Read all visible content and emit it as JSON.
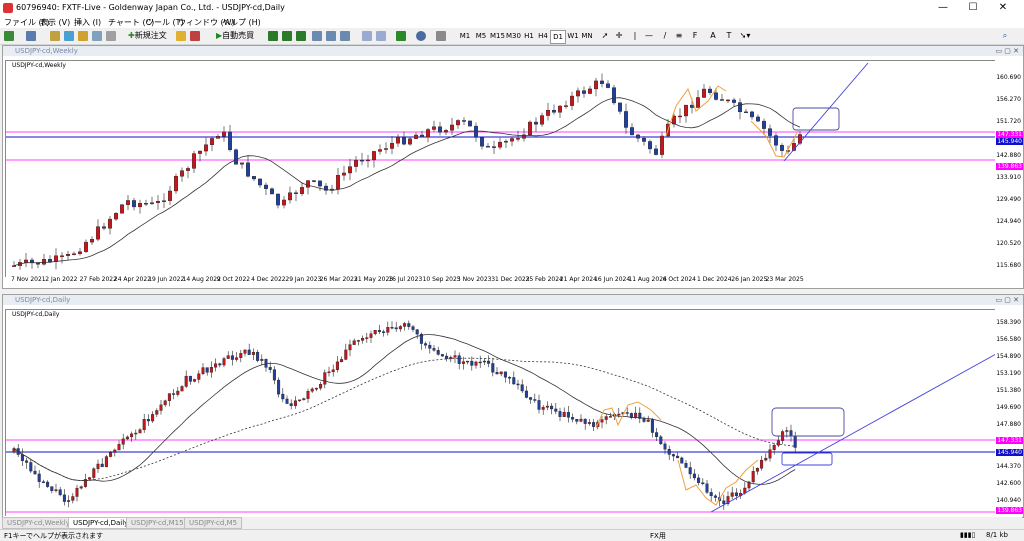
{
  "window": {
    "title": "60796940: FXTF-Live - Goldenway Japan Co., Ltd. - USDJPY-cd,Daily",
    "minimize": "—",
    "maximize": "☐",
    "close": "✕"
  },
  "menu": [
    "ファイル (F)",
    "表示 (V)",
    "挿入 (I)",
    "チャート (C)",
    "ツール (T)",
    "ウィンドウ (W)",
    "ヘルプ (H)"
  ],
  "toolbar": {
    "new_order": "新規注文",
    "auto_trade": "自動売買",
    "timeframes": [
      "M1",
      "M5",
      "M15",
      "M30",
      "H1",
      "H4",
      "D1",
      "W1",
      "MN"
    ],
    "selected_timeframe": "D1",
    "text_tool": "A",
    "label_tool": "T"
  },
  "colors": {
    "pink_line": "#ff00ff",
    "blue_line": "#1010cc",
    "trend_line": "#4040e0",
    "bull": "#c8151b",
    "bear": "#2040a0",
    "box": "#4a4aa0",
    "orange": "#f0a040"
  },
  "weekly": {
    "window_label": "USDJPY-cd,Weekly",
    "symbol_label": "USDJPY-cd,Weekly",
    "price_ticks": [
      "160.690",
      "156.270",
      "151.720",
      "147.330",
      "142.880",
      "138.460",
      "133.910",
      "129.490",
      "124.940",
      "120.520",
      "115.680"
    ],
    "pink_price": "147.331",
    "bid_price": "145.940",
    "low_pink_price": "139.863",
    "x_labels": [
      "7 Nov 2021",
      "2 Jan 2022",
      "27 Feb 2022",
      "24 Apr 2022",
      "19 Jun 2022",
      "14 Aug 2022",
      "9 Oct 2022",
      "4 Dec 2022",
      "29 Jan 2023",
      "26 Mar 2023",
      "21 May 2023",
      "16 Jul 2023",
      "10 Sep 2023",
      "5 Nov 2023",
      "31 Dec 2023",
      "25 Feb 2024",
      "21 Apr 2024",
      "16 Jun 2024",
      "11 Aug 2024",
      "6 Oct 2024",
      "1 Dec 2024",
      "26 Jan 2025",
      "23 Mar 2025"
    ]
  },
  "daily": {
    "window_label": "USDJPY-cd,Daily",
    "symbol_label": "USDJPY-cd,Daily",
    "price_ticks": [
      "158.390",
      "156.580",
      "154.890",
      "153.190",
      "151.380",
      "149.690",
      "147.880",
      "146.180",
      "144.370",
      "142.600",
      "140.940",
      "139.130"
    ],
    "pink_price": "147.331",
    "bid_price": "145.940",
    "low_pink_price": "139.863"
  },
  "tabs": [
    "USDJPY-cd,Weekly",
    "USDJPY-cd,Daily",
    "USDJPY-cd,M15",
    "USDJPY-cd,M5"
  ],
  "status": {
    "help": "F1キーでヘルプが表示されます",
    "profile": "FX用",
    "traffic": "8/1 kb"
  }
}
